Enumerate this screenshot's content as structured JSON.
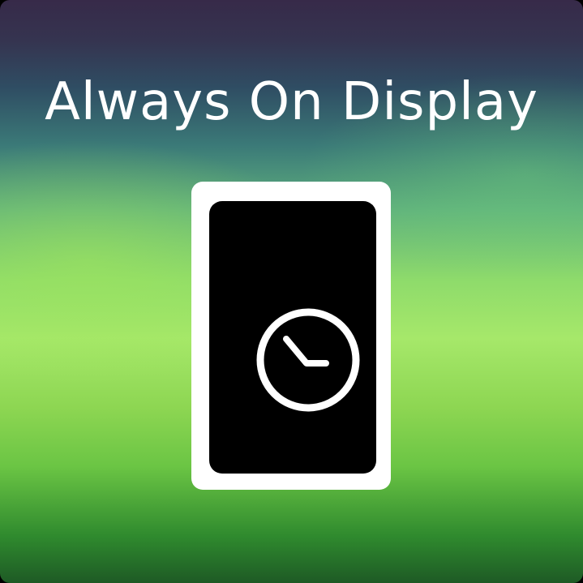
{
  "title": "Always On Display",
  "icons": {
    "phone": "phone-icon",
    "clock": "clock-icon"
  },
  "colors": {
    "title_text": "#ffffff",
    "phone_frame": "#ffffff",
    "phone_screen": "#000000",
    "clock_stroke": "#ffffff",
    "gradient_top": "#372a49",
    "gradient_middle": "#a6e86a",
    "gradient_bottom": "#1e5a25"
  }
}
